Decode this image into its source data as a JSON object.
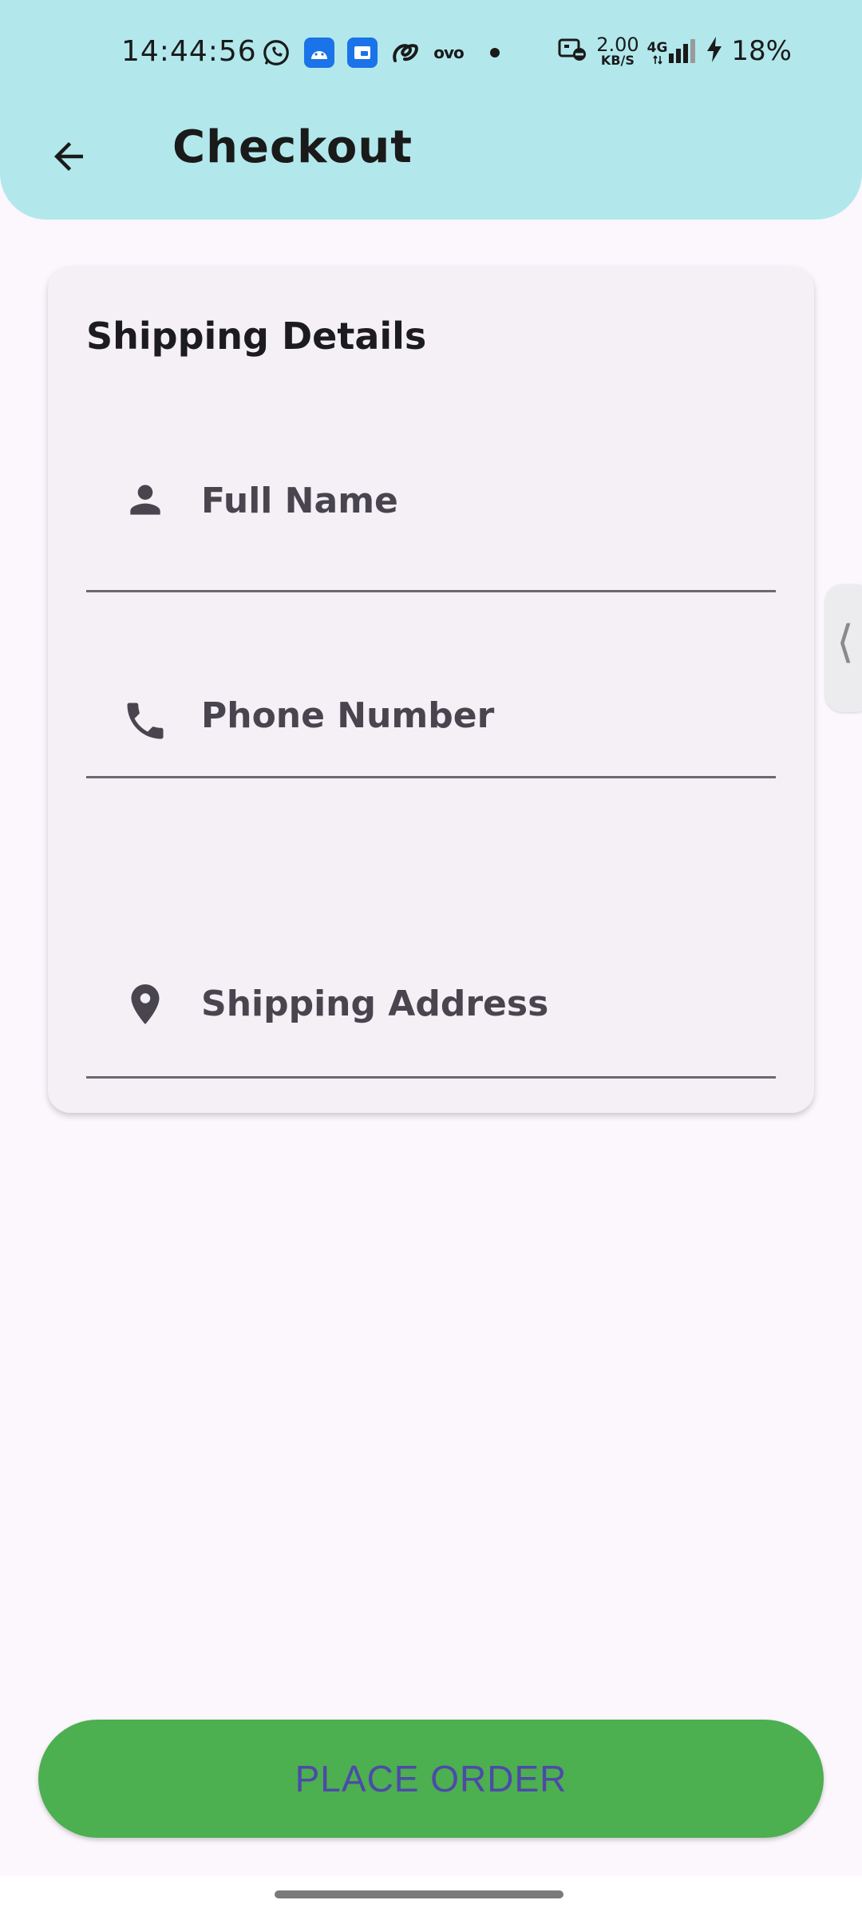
{
  "status_bar": {
    "time": "14:44:56",
    "notification_icons": [
      "whatsapp-icon",
      "android-app-icon",
      "app-notification-icon",
      "ovo-swirl-icon",
      "ovo-app-icon",
      "more-dot-icon"
    ],
    "ovo_text": "ovo",
    "net_speed_value": "2.00",
    "net_speed_unit": "KB/S",
    "network_type": "4G",
    "battery_percent": "18%"
  },
  "app_bar": {
    "title": "Checkout",
    "back_icon": "arrow-back-icon",
    "background_color": "#b2e8ec"
  },
  "shipping_card": {
    "title": "Shipping Details",
    "fields": [
      {
        "label": "Full Name",
        "icon": "person-icon",
        "value": ""
      },
      {
        "label": "Phone Number",
        "icon": "phone-icon",
        "value": ""
      },
      {
        "label": "Shipping Address",
        "icon": "location-pin-icon",
        "value": ""
      }
    ]
  },
  "side_handle": {
    "glyph": "⟨"
  },
  "actions": {
    "place_order_label": "PLACE ORDER",
    "place_order_color": "#4caf50"
  }
}
